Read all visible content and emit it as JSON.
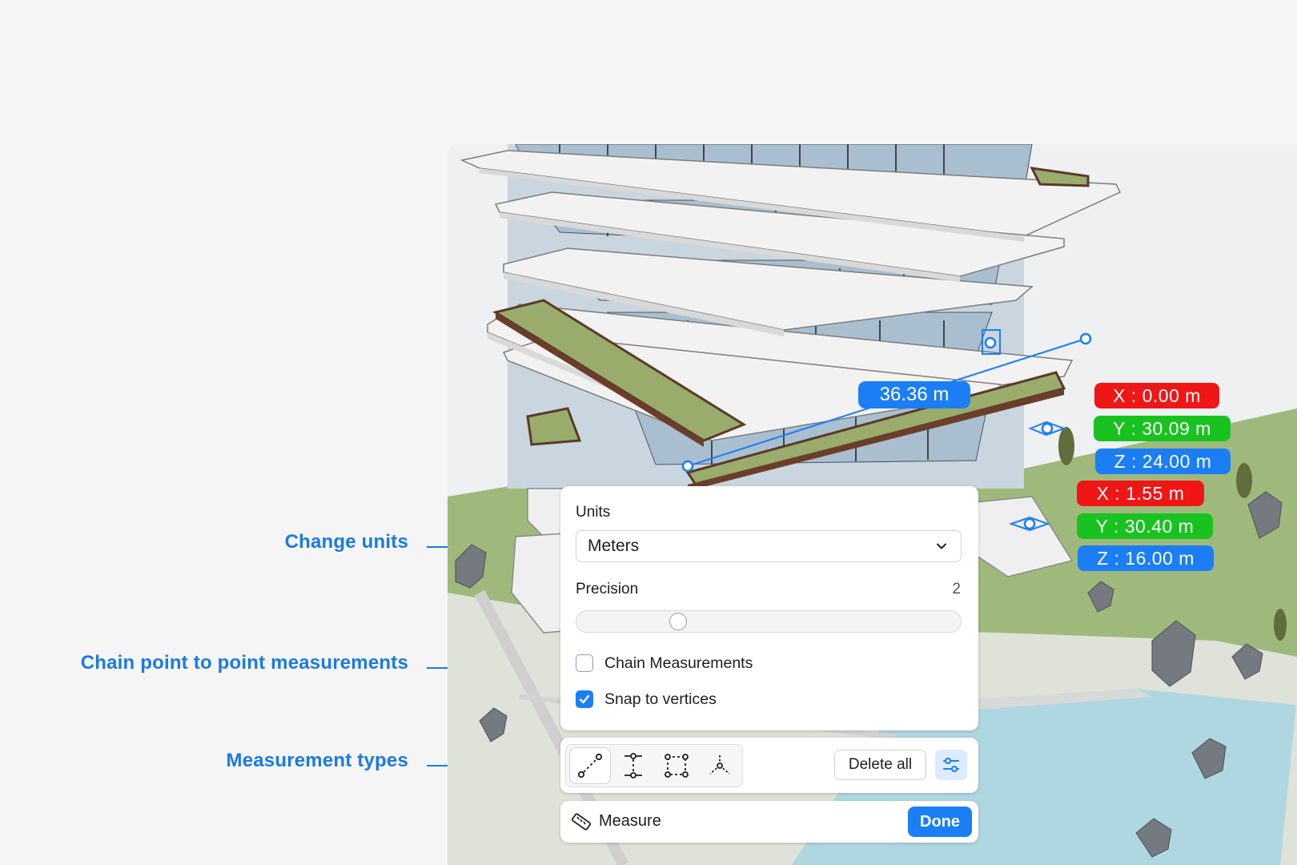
{
  "callouts": {
    "change_units": "Change units",
    "chain_measurements": "Chain point to point measurements",
    "measurement_types": "Measurement types"
  },
  "viewport": {
    "distance_label": "36.36 m",
    "point_a": {
      "x": "X : 0.00 m",
      "y": "Y : 30.09 m",
      "z": "Z : 24.00 m"
    },
    "point_b": {
      "x": "X : 1.55 m",
      "y": "Y : 30.40 m",
      "z": "Z : 16.00 m"
    }
  },
  "settings": {
    "units_label": "Units",
    "units_value": "Meters",
    "precision_label": "Precision",
    "precision_value": "2",
    "chain_label": "Chain Measurements",
    "chain_checked": false,
    "snap_label": "Snap to vertices",
    "snap_checked": true
  },
  "toolbar": {
    "tools": [
      "point-to-point-icon",
      "vertical-distance-icon",
      "area-icon",
      "point-coordinates-icon"
    ],
    "active_tool": "point-to-point-icon",
    "delete_all": "Delete all",
    "filter_icon": "sliders-icon"
  },
  "measure_bar": {
    "label": "Measure",
    "done": "Done",
    "icon": "ruler-icon"
  },
  "colors": {
    "accent": "#1b7ef4",
    "callout": "#1a7be0",
    "x_axis": "#f01616",
    "y_axis": "#19c31f",
    "z_axis": "#1b7ef4"
  }
}
